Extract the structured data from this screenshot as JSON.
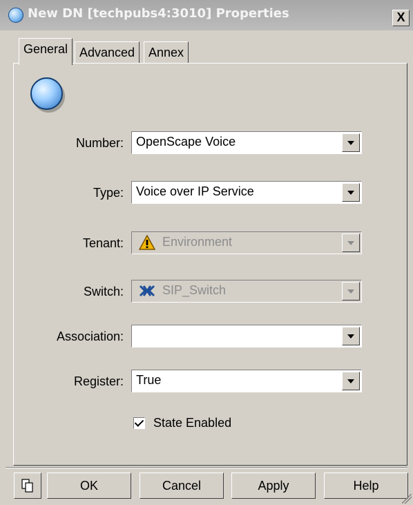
{
  "window": {
    "title": "New DN [techpubs4:3010] Properties",
    "close_label": "X"
  },
  "tabs": [
    {
      "label": "General",
      "active": true
    },
    {
      "label": "Advanced",
      "active": false
    },
    {
      "label": "Annex",
      "active": false
    }
  ],
  "form": {
    "number": {
      "label": "Number:",
      "value": "OpenScape Voice"
    },
    "type": {
      "label": "Type:",
      "value": "Voice over IP Service"
    },
    "tenant": {
      "label": "Tenant:",
      "value": "Environment",
      "icon": "warning-icon",
      "disabled": true
    },
    "switch": {
      "label": "Switch:",
      "value": "SIP_Switch",
      "icon": "switch-icon",
      "disabled": true
    },
    "association": {
      "label": "Association:",
      "value": ""
    },
    "register": {
      "label": "Register:",
      "value": "True"
    },
    "state_enabled": {
      "label": "State Enabled",
      "checked": true
    }
  },
  "buttons": {
    "ok": "OK",
    "cancel": "Cancel",
    "apply": "Apply",
    "help": "Help"
  },
  "colors": {
    "dialog_bg": "#d4d0c8",
    "titlebar_inactive": "#a7a7a7",
    "dn_icon": "#7fbaf0"
  }
}
